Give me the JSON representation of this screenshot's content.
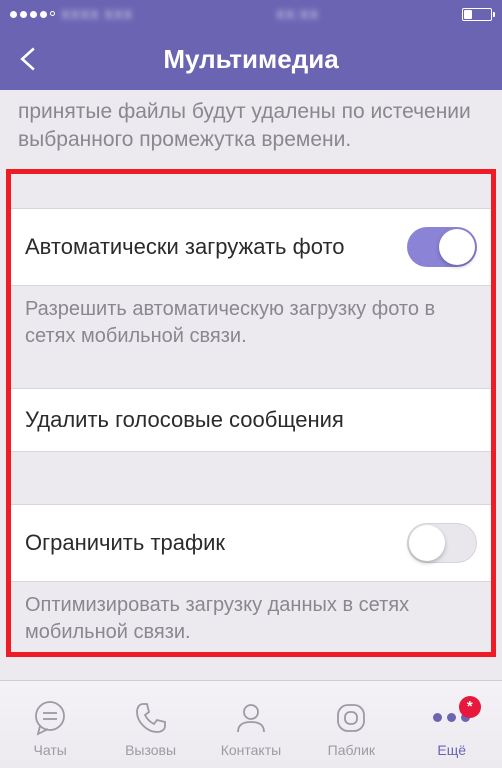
{
  "status": {
    "carrier_blur": "XXXX XXX",
    "time_blur": "XX:XX"
  },
  "nav": {
    "title": "Мультимедиа"
  },
  "intro": "принятые файлы будут удалены по истечении выбранного промежутка времени.",
  "rows": {
    "auto_photo": {
      "label": "Автоматически загружать фото",
      "footer": "Разрешить автоматическую загрузку фото в сетях мобильной связи."
    },
    "delete_voice": {
      "label": "Удалить голосовые сообщения"
    },
    "limit_traffic": {
      "label": "Ограничить трафик",
      "footer": "Оптимизировать загрузку данных в сетях мобильной связи."
    }
  },
  "tabs": {
    "chats": "Чаты",
    "calls": "Вызовы",
    "contacts": "Контакты",
    "public": "Паблик",
    "more": "Ещё",
    "badge": "*"
  }
}
